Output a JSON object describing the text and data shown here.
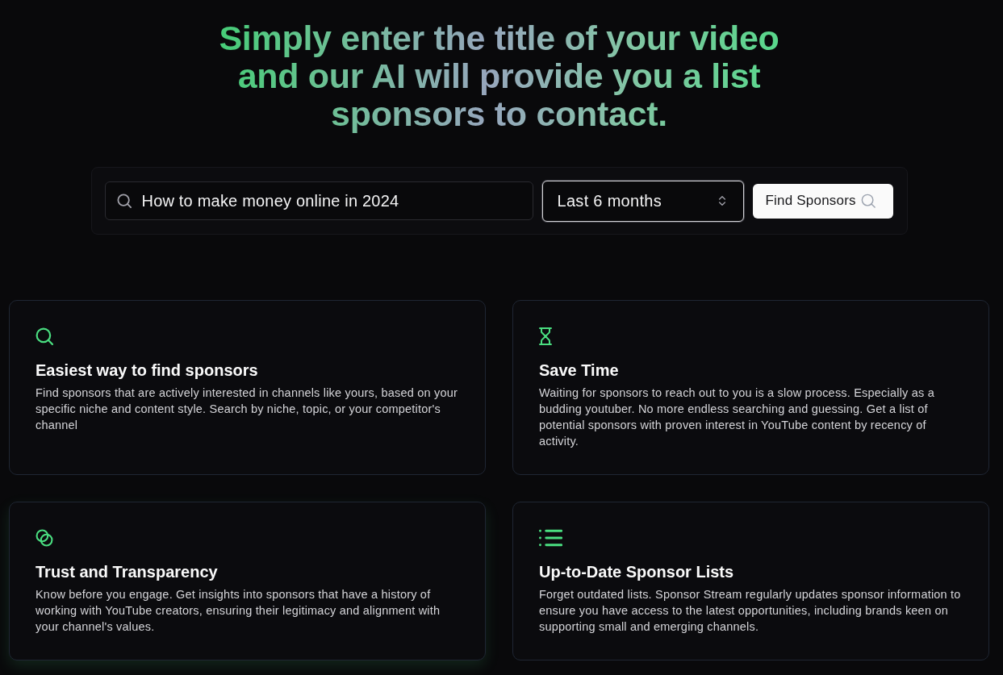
{
  "headline": "Simply enter the title of your video and our AI will provide you a list sponsors to contact.",
  "search": {
    "query": {
      "value": "How to make money online in 2024"
    },
    "period": {
      "value": "Last 6 months",
      "focused": true
    },
    "submit": {
      "label": "Find Sponsors"
    }
  },
  "features": [
    {
      "title": "Easiest way to find sponsors",
      "description": "Find sponsors that are actively interested in channels like yours, based on your specific niche and content style. Search by niche, topic, or your competitor's channel",
      "highlighted": false
    },
    {
      "title": "Save Time",
      "description": "Waiting for sponsors to reach out to you is a slow process. Especially as a budding youtuber. No more endless searching and guessing. Get a list of potential sponsors with proven interest in YouTube content by recency of activity.",
      "highlighted": false
    },
    {
      "title": "Trust and Transparency",
      "description": "Know before you engage. Get insights into sponsors that have a history of working with YouTube creators, ensuring their legitimacy and alignment with your channel's values.",
      "highlighted": true
    },
    {
      "title": "Up-to-Date Sponsor Lists",
      "description": "Forget outdated lists. Sponsor Stream regularly updates sponsor information to ensure you have access to the latest opportunities, including brands keen on supporting small and emerging channels.",
      "highlighted": false
    }
  ]
}
